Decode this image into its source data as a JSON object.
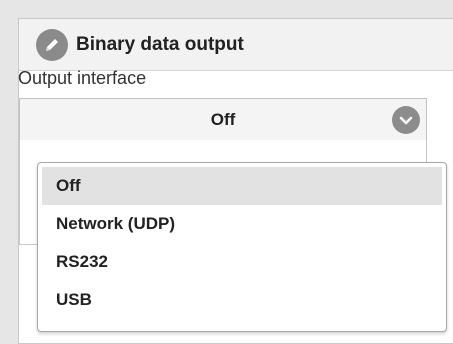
{
  "panel": {
    "title": "Binary data output",
    "title_icon": "pencil-icon"
  },
  "output_interface": {
    "label": "Output interface",
    "selected_value": "Off",
    "expand_icon": "chevron-down-icon",
    "options": [
      "Off",
      "Network (UDP)",
      "RS232",
      "USB"
    ],
    "highlighted_option": "Off"
  },
  "colors": {
    "page_background": "#e6e6e6",
    "header_background": "#f2f2f2",
    "icon_gray": "#8a8a8a",
    "option_highlight": "#e2e2e2"
  }
}
